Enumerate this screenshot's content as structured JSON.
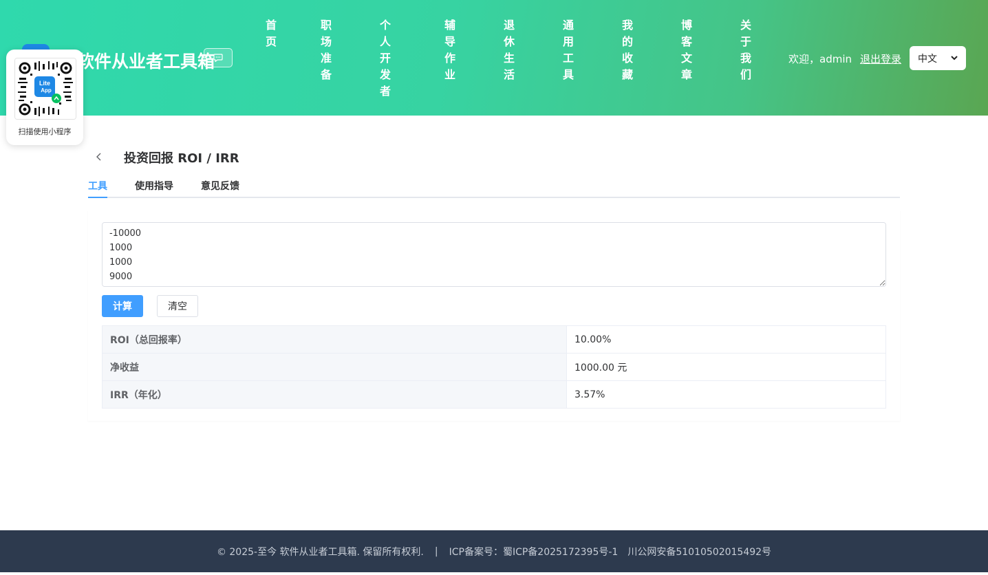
{
  "header": {
    "site_title": "软件从业者工具箱",
    "nav": [
      "首页",
      "职场准备",
      "个人开发者",
      "辅导作业",
      "退休生活",
      "通用工具",
      "我的收藏",
      "博客文章",
      "关于我们"
    ],
    "welcome": "欢迎，admin",
    "logout": "退出登录",
    "language": "中文",
    "chat_icon": "chat-icon"
  },
  "qr_card": {
    "caption": "扫描使用小程序",
    "badge_text_line1": "Lite",
    "badge_text_line2": "App"
  },
  "main": {
    "back_icon": "chevron-left-icon",
    "title": "投资回报 ROI / IRR",
    "tabs": [
      {
        "label": "工具"
      },
      {
        "label": "使用指导"
      },
      {
        "label": "意见反馈"
      }
    ],
    "cashflow_input": "-10000\n1000\n1000\n9000",
    "calc_button": "计算",
    "clear_button": "清空",
    "results": [
      {
        "label": "ROI（总回报率）",
        "value": "10.00%"
      },
      {
        "label": "净收益",
        "value": "1000.00 元"
      },
      {
        "label": "IRR（年化）",
        "value": "3.57%"
      }
    ]
  },
  "footer": {
    "copyright": "© 2025-至今 软件从业者工具箱. 保留所有权利.",
    "separator": "|",
    "icp": "ICP备案号：蜀ICP备2025172395号-1",
    "police": "川公网安备51010502015492号"
  },
  "colors": {
    "primary": "#409eff",
    "header_gradient_start": "#2fd9ad",
    "header_gradient_end": "#5aa652",
    "footer_bg": "#2d3a4e"
  }
}
